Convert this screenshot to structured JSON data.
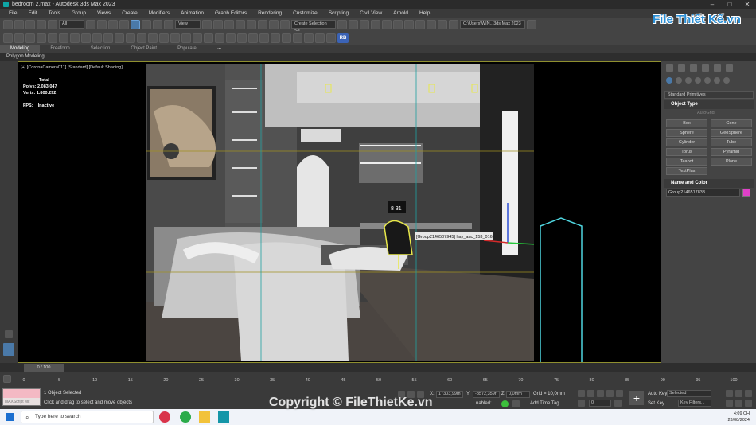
{
  "window": {
    "title": "bedroom 2.max - Autodesk 3ds Max 2023",
    "controls": [
      "–",
      "□",
      "✕"
    ]
  },
  "menu": [
    "File",
    "Edit",
    "Tools",
    "Group",
    "Views",
    "Create",
    "Modifiers",
    "Animation",
    "Graph Editors",
    "Rendering",
    "Customize",
    "Scripting",
    "Civil View",
    "Arnold",
    "Help"
  ],
  "toolbar": {
    "filter": "All",
    "view": "View",
    "create_selection_set": "Create Selection Se",
    "workspace_path": "C:\\Users\\WIN...3ds Max 2023",
    "rb_label": "RB"
  },
  "ribbon": {
    "tabs": [
      "Modeling",
      "Freeform",
      "Selection",
      "Object Paint",
      "Populate"
    ],
    "active": "Modeling",
    "sub": "Polygon Modeling"
  },
  "viewport": {
    "label": "[+] [CoronaCamera011] [Standard] [Default Shading]",
    "stats_header": "Total",
    "polys_label": "Polys:",
    "polys": "2.083.047",
    "verts_label": "Verts:",
    "verts": "1.800.292",
    "fps_label": "FPS:",
    "fps": "Inactive",
    "tooltip": "[Group2146507945] hay_aac_153_016",
    "clock": "8 31"
  },
  "command_panel": {
    "primitive_type": "Standard Primitives",
    "object_type_header": "Object Type",
    "autogrid": "AutoGrid",
    "buttons": [
      "Box",
      "Cone",
      "Sphere",
      "GeoSphere",
      "Cylinder",
      "Tube",
      "Torus",
      "Pyramid",
      "Teapot",
      "Plane",
      "TextPlus"
    ],
    "name_color_header": "Name and Color",
    "object_name": "Group2146517833",
    "object_color": "#e040c8"
  },
  "timeline": {
    "slider": "0 / 100",
    "ticks": [
      "0",
      "5",
      "10",
      "15",
      "20",
      "25",
      "30",
      "35",
      "40",
      "45",
      "50",
      "55",
      "60",
      "65",
      "70",
      "75",
      "80",
      "85",
      "90",
      "95",
      "100"
    ]
  },
  "status": {
    "maxscript": "MAXScript Mi:",
    "selected": "1 Object Selected",
    "hint": "Click and drag to select and move objects",
    "x_label": "X:",
    "x": "17303,99m",
    "y_label": "Y:",
    "y": "-8572,359r",
    "z_label": "Z:",
    "z": "0,0mm",
    "grid": "Grid = 10,0mm",
    "enabled": "nabled:",
    "add_time_tag": "Add Time Tag",
    "auto_key": "Auto Key",
    "set_key": "Set Key",
    "selected_dd": "Selected",
    "key_filters": "Key Filters...",
    "frame": "0"
  },
  "taskbar": {
    "search": "Type here to search",
    "time": "4:09 CH",
    "date": "23/08/2024"
  },
  "watermark": {
    "brand": "File Thiết Kế.vn",
    "copyright": "Copyright © FileThietKe.vn"
  }
}
